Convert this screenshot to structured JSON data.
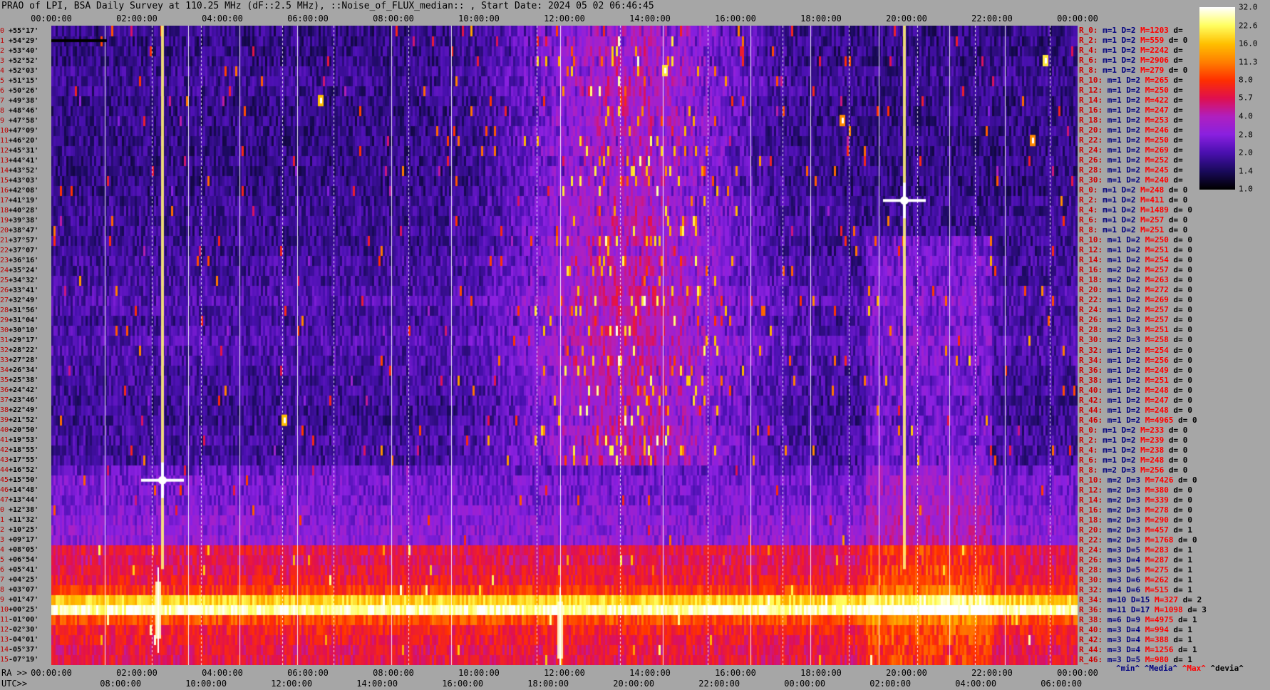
{
  "title": "PRAO of LPI, BSA Daily Survey at 110.25 MHz (dF::2.5 MHz), ::Noise_of_FLUX_median:: , Start Date: 2024 05 02 06:46:45",
  "top_axis": {
    "ticks": [
      "00:00:00",
      "02:00:00",
      "04:00:00",
      "06:00:00",
      "08:00:00",
      "10:00:00",
      "12:00:00",
      "14:00:00",
      "16:00:00",
      "18:00:00",
      "20:00:00",
      "22:00:00",
      "00:00:00"
    ]
  },
  "ra_axis": {
    "prefix": "RA >>",
    "ticks": [
      "00:00:00",
      "02:00:00",
      "04:00:00",
      "06:00:00",
      "08:00:00",
      "10:00:00",
      "12:00:00",
      "14:00:00",
      "16:00:00",
      "18:00:00",
      "20:00:00",
      "22:00:00",
      "00:00:00"
    ]
  },
  "utc_axis": {
    "prefix": "UTC>>",
    "ticks": [
      "08:00:00",
      "10:00:00",
      "12:00:00",
      "14:00:00",
      "16:00:00",
      "18:00:00",
      "20:00:00",
      "22:00:00",
      "00:00:00",
      "02:00:00",
      "04:00:00",
      "06:00:00"
    ]
  },
  "declinations": [
    {
      "idx": "0",
      "dec": "+55°17'"
    },
    {
      "idx": "1",
      "dec": "+54°29'"
    },
    {
      "idx": "2",
      "dec": "+53°40'"
    },
    {
      "idx": "3",
      "dec": "+52°52'"
    },
    {
      "idx": "4",
      "dec": "+52°03'"
    },
    {
      "idx": "5",
      "dec": "+51°15'"
    },
    {
      "idx": "6",
      "dec": "+50°26'"
    },
    {
      "idx": "7",
      "dec": "+49°38'"
    },
    {
      "idx": "8",
      "dec": "+48°46'"
    },
    {
      "idx": "9",
      "dec": "+47°58'"
    },
    {
      "idx": "10",
      "dec": "+47°09'"
    },
    {
      "idx": "11",
      "dec": "+46°20'"
    },
    {
      "idx": "12",
      "dec": "+45°31'"
    },
    {
      "idx": "13",
      "dec": "+44°41'"
    },
    {
      "idx": "14",
      "dec": "+43°52'"
    },
    {
      "idx": "15",
      "dec": "+43°03'"
    },
    {
      "idx": "16",
      "dec": "+42°08'"
    },
    {
      "idx": "17",
      "dec": "+41°19'"
    },
    {
      "idx": "18",
      "dec": "+40°28'"
    },
    {
      "idx": "19",
      "dec": "+39°38'"
    },
    {
      "idx": "20",
      "dec": "+38°47'"
    },
    {
      "idx": "21",
      "dec": "+37°57'"
    },
    {
      "idx": "22",
      "dec": "+37°07'"
    },
    {
      "idx": "23",
      "dec": "+36°16'"
    },
    {
      "idx": "24",
      "dec": "+35°24'"
    },
    {
      "idx": "25",
      "dec": "+34°32'"
    },
    {
      "idx": "26",
      "dec": "+33°41'"
    },
    {
      "idx": "27",
      "dec": "+32°49'"
    },
    {
      "idx": "28",
      "dec": "+31°56'"
    },
    {
      "idx": "29",
      "dec": "+31°04'"
    },
    {
      "idx": "30",
      "dec": "+30°10'"
    },
    {
      "idx": "31",
      "dec": "+29°17'"
    },
    {
      "idx": "32",
      "dec": "+28°22'"
    },
    {
      "idx": "33",
      "dec": "+27°28'"
    },
    {
      "idx": "34",
      "dec": "+26°34'"
    },
    {
      "idx": "35",
      "dec": "+25°38'"
    },
    {
      "idx": "36",
      "dec": "+24°42'"
    },
    {
      "idx": "37",
      "dec": "+23°46'"
    },
    {
      "idx": "38",
      "dec": "+22°49'"
    },
    {
      "idx": "39",
      "dec": "+21°52'"
    },
    {
      "idx": "40",
      "dec": "+20°50'"
    },
    {
      "idx": "41",
      "dec": "+19°53'"
    },
    {
      "idx": "42",
      "dec": "+18°55'"
    },
    {
      "idx": "43",
      "dec": "+17°55'"
    },
    {
      "idx": "44",
      "dec": "+16°52'"
    },
    {
      "idx": "45",
      "dec": "+15°50'"
    },
    {
      "idx": "46",
      "dec": "+14°48'"
    },
    {
      "idx": "47",
      "dec": "+13°44'"
    },
    {
      "idx": "0",
      "dec": "+12°38'"
    },
    {
      "idx": "1",
      "dec": "+11°32'"
    },
    {
      "idx": "2",
      "dec": "+10°25'"
    },
    {
      "idx": "3",
      "dec": "+09°17'"
    },
    {
      "idx": "4",
      "dec": "+08°05'"
    },
    {
      "idx": "5",
      "dec": "+06°54'"
    },
    {
      "idx": "6",
      "dec": "+05°41'"
    },
    {
      "idx": "7",
      "dec": "+04°25'"
    },
    {
      "idx": "8",
      "dec": "+03°07'"
    },
    {
      "idx": "9",
      "dec": "+01°47'"
    },
    {
      "idx": "10",
      "dec": "+00°25'"
    },
    {
      "idx": "11",
      "dec": "-01°00'"
    },
    {
      "idx": "12",
      "dec": "-02°30'"
    },
    {
      "idx": "13",
      "dec": "-04°01'"
    },
    {
      "idx": "14",
      "dec": "-05°37'"
    },
    {
      "idx": "15",
      "dec": "-07°19'"
    }
  ],
  "stats": [
    {
      "r": "R_0:",
      "m": "m=1",
      "d": "D=2",
      "mx": "M=1203",
      "dv": "d="
    },
    {
      "r": "R_2:",
      "m": "m=1",
      "d": "D=2",
      "mx": "M=559",
      "dv": "d= 0"
    },
    {
      "r": "R_4:",
      "m": "m=1",
      "d": "D=2",
      "mx": "M=2242",
      "dv": "d="
    },
    {
      "r": "R_6:",
      "m": "m=1",
      "d": "D=2",
      "mx": "M=2906",
      "dv": "d="
    },
    {
      "r": "R_8:",
      "m": "m=1",
      "d": "D=2",
      "mx": "M=279",
      "dv": "d= 0"
    },
    {
      "r": "R_10:",
      "m": "m=1",
      "d": "D=2",
      "mx": "M=265",
      "dv": "d="
    },
    {
      "r": "R_12:",
      "m": "m=1",
      "d": "D=2",
      "mx": "M=250",
      "dv": "d="
    },
    {
      "r": "R_14:",
      "m": "m=1",
      "d": "D=2",
      "mx": "M=422",
      "dv": "d="
    },
    {
      "r": "R_16:",
      "m": "m=1",
      "d": "D=2",
      "mx": "M=247",
      "dv": "d="
    },
    {
      "r": "R_18:",
      "m": "m=1",
      "d": "D=2",
      "mx": "M=253",
      "dv": "d="
    },
    {
      "r": "R_20:",
      "m": "m=1",
      "d": "D=2",
      "mx": "M=246",
      "dv": "d="
    },
    {
      "r": "R_22:",
      "m": "m=1",
      "d": "D=2",
      "mx": "M=250",
      "dv": "d="
    },
    {
      "r": "R_24:",
      "m": "m=1",
      "d": "D=2",
      "mx": "M=269",
      "dv": "d="
    },
    {
      "r": "R_26:",
      "m": "m=1",
      "d": "D=2",
      "mx": "M=252",
      "dv": "d="
    },
    {
      "r": "R_28:",
      "m": "m=1",
      "d": "D=2",
      "mx": "M=245",
      "dv": "d="
    },
    {
      "r": "R_30:",
      "m": "m=1",
      "d": "D=2",
      "mx": "M=240",
      "dv": "d="
    },
    {
      "r": "R_0:",
      "m": "m=1",
      "d": "D=2",
      "mx": "M=248",
      "dv": "d= 0"
    },
    {
      "r": "R_2:",
      "m": "m=1",
      "d": "D=2",
      "mx": "M=411",
      "dv": "d= 0"
    },
    {
      "r": "R_4:",
      "m": "m=1",
      "d": "D=2",
      "mx": "M=1489",
      "dv": "d= 0"
    },
    {
      "r": "R_6:",
      "m": "m=1",
      "d": "D=2",
      "mx": "M=257",
      "dv": "d= 0"
    },
    {
      "r": "R_8:",
      "m": "m=1",
      "d": "D=2",
      "mx": "M=251",
      "dv": "d= 0"
    },
    {
      "r": "R_10:",
      "m": "m=1",
      "d": "D=2",
      "mx": "M=250",
      "dv": "d= 0"
    },
    {
      "r": "R_12:",
      "m": "m=1",
      "d": "D=2",
      "mx": "M=251",
      "dv": "d= 0"
    },
    {
      "r": "R_14:",
      "m": "m=1",
      "d": "D=2",
      "mx": "M=254",
      "dv": "d= 0"
    },
    {
      "r": "R_16:",
      "m": "m=2",
      "d": "D=2",
      "mx": "M=257",
      "dv": "d= 0"
    },
    {
      "r": "R_18:",
      "m": "m=2",
      "d": "D=2",
      "mx": "M=263",
      "dv": "d= 0"
    },
    {
      "r": "R_20:",
      "m": "m=1",
      "d": "D=2",
      "mx": "M=272",
      "dv": "d= 0"
    },
    {
      "r": "R_22:",
      "m": "m=1",
      "d": "D=2",
      "mx": "M=269",
      "dv": "d= 0"
    },
    {
      "r": "R_24:",
      "m": "m=1",
      "d": "D=2",
      "mx": "M=257",
      "dv": "d= 0"
    },
    {
      "r": "R_26:",
      "m": "m=1",
      "d": "D=2",
      "mx": "M=257",
      "dv": "d= 0"
    },
    {
      "r": "R_28:",
      "m": "m=2",
      "d": "D=3",
      "mx": "M=251",
      "dv": "d= 0"
    },
    {
      "r": "R_30:",
      "m": "m=2",
      "d": "D=3",
      "mx": "M=258",
      "dv": "d= 0"
    },
    {
      "r": "R_32:",
      "m": "m=1",
      "d": "D=2",
      "mx": "M=254",
      "dv": "d= 0"
    },
    {
      "r": "R_34:",
      "m": "m=1",
      "d": "D=2",
      "mx": "M=256",
      "dv": "d= 0"
    },
    {
      "r": "R_36:",
      "m": "m=1",
      "d": "D=2",
      "mx": "M=249",
      "dv": "d= 0"
    },
    {
      "r": "R_38:",
      "m": "m=1",
      "d": "D=2",
      "mx": "M=251",
      "dv": "d= 0"
    },
    {
      "r": "R_40:",
      "m": "m=1",
      "d": "D=2",
      "mx": "M=248",
      "dv": "d= 0"
    },
    {
      "r": "R_42:",
      "m": "m=1",
      "d": "D=2",
      "mx": "M=247",
      "dv": "d= 0"
    },
    {
      "r": "R_44:",
      "m": "m=1",
      "d": "D=2",
      "mx": "M=248",
      "dv": "d= 0"
    },
    {
      "r": "R_46:",
      "m": "m=1",
      "d": "D=2",
      "mx": "M=4965",
      "dv": "d= 0"
    },
    {
      "r": "R_0:",
      "m": "m=1",
      "d": "D=2",
      "mx": "M=233",
      "dv": "d= 0"
    },
    {
      "r": "R_2:",
      "m": "m=1",
      "d": "D=2",
      "mx": "M=239",
      "dv": "d= 0"
    },
    {
      "r": "R_4:",
      "m": "m=1",
      "d": "D=2",
      "mx": "M=238",
      "dv": "d= 0"
    },
    {
      "r": "R_6:",
      "m": "m=1",
      "d": "D=2",
      "mx": "M=248",
      "dv": "d= 0"
    },
    {
      "r": "R_8:",
      "m": "m=2",
      "d": "D=3",
      "mx": "M=256",
      "dv": "d= 0"
    },
    {
      "r": "R_10:",
      "m": "m=2",
      "d": "D=3",
      "mx": "M=7426",
      "dv": "d= 0"
    },
    {
      "r": "R_12:",
      "m": "m=2",
      "d": "D=3",
      "mx": "M=380",
      "dv": "d= 0"
    },
    {
      "r": "R_14:",
      "m": "m=2",
      "d": "D=3",
      "mx": "M=339",
      "dv": "d= 0"
    },
    {
      "r": "R_16:",
      "m": "m=2",
      "d": "D=3",
      "mx": "M=278",
      "dv": "d= 0"
    },
    {
      "r": "R_18:",
      "m": "m=2",
      "d": "D=3",
      "mx": "M=290",
      "dv": "d= 0"
    },
    {
      "r": "R_20:",
      "m": "m=2",
      "d": "D=3",
      "mx": "M=457",
      "dv": "d= 1"
    },
    {
      "r": "R_22:",
      "m": "m=2",
      "d": "D=3",
      "mx": "M=1768",
      "dv": "d= 0"
    },
    {
      "r": "R_24:",
      "m": "m=3",
      "d": "D=5",
      "mx": "M=283",
      "dv": "d= 1"
    },
    {
      "r": "R_26:",
      "m": "m=3",
      "d": "D=4",
      "mx": "M=287",
      "dv": "d= 1"
    },
    {
      "r": "R_28:",
      "m": "m=3",
      "d": "D=5",
      "mx": "M=275",
      "dv": "d= 1"
    },
    {
      "r": "R_30:",
      "m": "m=3",
      "d": "D=6",
      "mx": "M=262",
      "dv": "d= 1"
    },
    {
      "r": "R_32:",
      "m": "m=4",
      "d": "D=6",
      "mx": "M=515",
      "dv": "d= 1"
    },
    {
      "r": "R_34:",
      "m": "m=10",
      "d": "D=15",
      "mx": "M=327",
      "dv": "d= 2"
    },
    {
      "r": "R_36:",
      "m": "m=11",
      "d": "D=17",
      "mx": "M=1098",
      "dv": "d= 3"
    },
    {
      "r": "R_38:",
      "m": "m=6",
      "d": "D=9",
      "mx": "M=4975",
      "dv": "d= 1"
    },
    {
      "r": "R_40:",
      "m": "m=3",
      "d": "D=4",
      "mx": "M=994",
      "dv": "d= 1"
    },
    {
      "r": "R_42:",
      "m": "m=3",
      "d": "D=4",
      "mx": "M=388",
      "dv": "d= 1"
    },
    {
      "r": "R_44:",
      "m": "m=3",
      "d": "D=4",
      "mx": "M=1256",
      "dv": "d= 1"
    },
    {
      "r": "R_46:",
      "m": "m=3",
      "d": "D=5",
      "mx": "M=980",
      "dv": "d= 1"
    }
  ],
  "footer_legend": {
    "min": "^min^",
    "median": "^Media^",
    "max": "^Max^",
    "dev": "^devia^"
  },
  "colors": {
    "background": "#a6a6a6",
    "stat_r": "#d00000",
    "stat_median": "#000080",
    "stat_max": "#ff0000"
  },
  "chart_data": {
    "type": "heatmap",
    "title": "PRAO of LPI, BSA Daily Survey at 110.25 MHz (dF::2.5 MHz), ::Noise_of_FLUX_median:: , Start Date: 2024 05 02 06:46:45",
    "xlabel": "RA >>",
    "x_range_hours": [
      0,
      24
    ],
    "rows": 64,
    "colorbar": {
      "ticks": [
        32.0,
        22.6,
        16.0,
        11.3,
        8.0,
        5.7,
        4.0,
        2.8,
        2.0,
        1.4,
        1.0
      ],
      "scale": "log",
      "palette": [
        "#000000",
        "#1a0a5c",
        "#4a10b0",
        "#8a20e0",
        "#b020c0",
        "#e01050",
        "#ff3000",
        "#ff8000",
        "#ffc000",
        "#ffff60",
        "#ffffff"
      ]
    },
    "row_levels": [
      1.7,
      1.7,
      1.7,
      1.7,
      1.8,
      1.8,
      1.8,
      1.7,
      1.7,
      1.7,
      1.7,
      1.7,
      1.7,
      1.7,
      1.7,
      1.7,
      1.7,
      1.8,
      1.8,
      1.8,
      1.8,
      1.8,
      1.8,
      1.9,
      1.9,
      1.9,
      2.0,
      2.1,
      2.0,
      1.9,
      2.0,
      2.1,
      2.0,
      2.0,
      1.9,
      1.9,
      1.9,
      1.8,
      1.8,
      1.8,
      1.9,
      1.9,
      1.9,
      1.9,
      2.3,
      2.6,
      2.6,
      2.6,
      2.8,
      2.9,
      3.0,
      3.1,
      6.0,
      5.5,
      6.0,
      6.5,
      8.0,
      18.0,
      28.0,
      9.0,
      7.0,
      6.5,
      6.0,
      6.0
    ],
    "vertical_lines_hours": [
      1.25,
      2.35,
      3.2,
      3.5,
      4.4,
      5.4,
      5.75,
      6.6,
      7.95,
      8.35,
      9.35,
      11.35,
      11.9,
      13.3,
      14.3,
      15.35,
      16.35,
      17.1,
      17.75,
      18.65,
      19.35,
      20.25,
      21.0,
      21.6,
      22.3,
      23.35
    ],
    "sources": [
      {
        "ra_hours": 1.3,
        "row": 1,
        "level": 4.0,
        "kind": "streak"
      },
      {
        "ra_hours": 2.6,
        "row": 45,
        "level": 32.0,
        "kind": "cross"
      },
      {
        "ra_hours": 19.95,
        "row": 17,
        "level": 32.0,
        "kind": "cross"
      },
      {
        "ra_hours": 11.9,
        "row": 60,
        "level": 32.0,
        "kind": "burst"
      },
      {
        "ra_hours": 2.5,
        "row": 58,
        "level": 24.0,
        "kind": "burst"
      },
      {
        "ra_hours": 5.45,
        "row": 39,
        "level": 16.0,
        "kind": "spot"
      },
      {
        "ra_hours": 14.35,
        "row": 4,
        "level": 20.0,
        "kind": "spot"
      },
      {
        "ra_hours": 23.25,
        "row": 3,
        "level": 20.0,
        "kind": "spot"
      },
      {
        "ra_hours": 6.3,
        "row": 7,
        "level": 16.0,
        "kind": "spot"
      },
      {
        "ra_hours": 18.5,
        "row": 9,
        "level": 12.0,
        "kind": "spot"
      },
      {
        "ra_hours": 22.95,
        "row": 11,
        "level": 12.0,
        "kind": "spot"
      }
    ]
  }
}
